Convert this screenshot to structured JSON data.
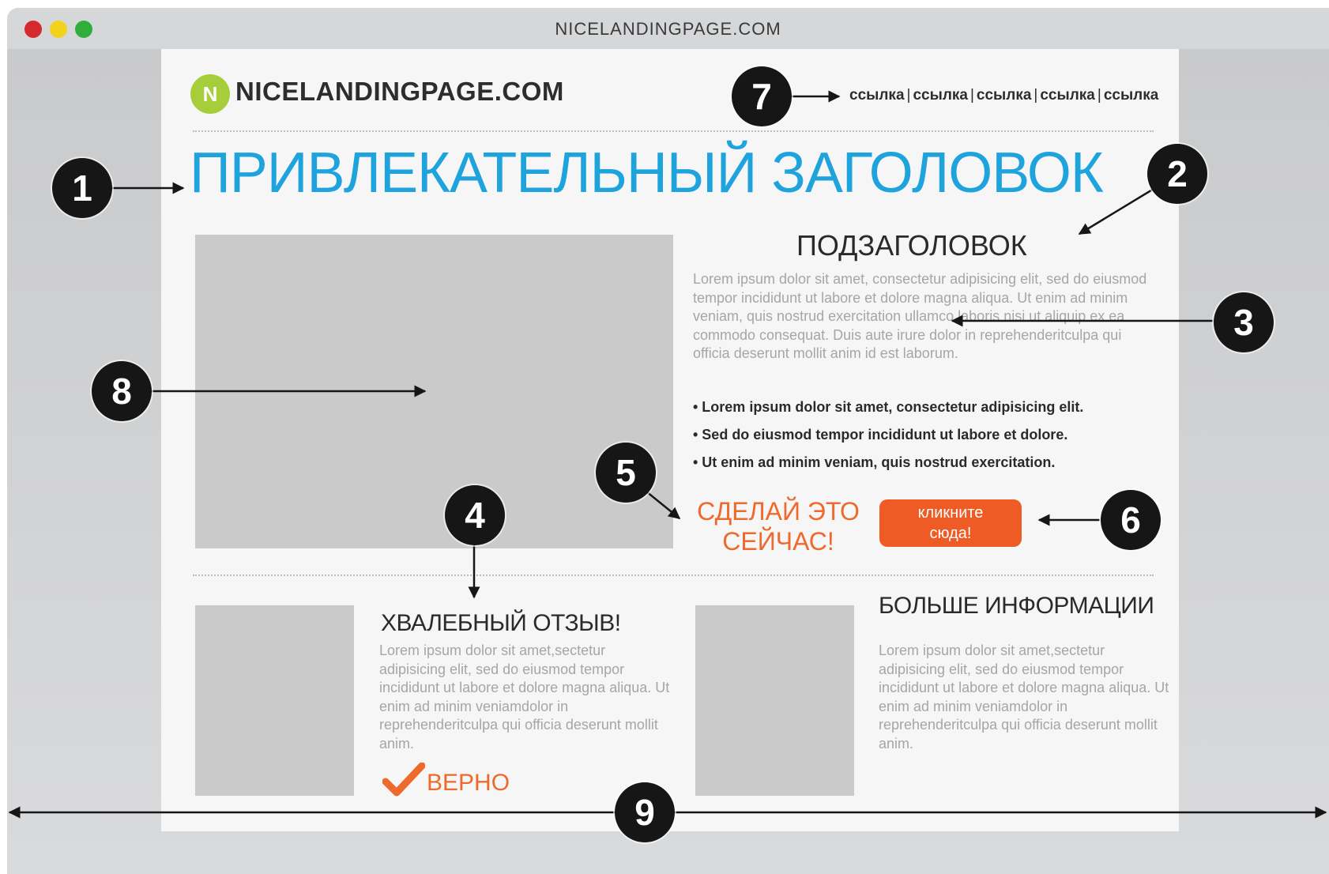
{
  "window": {
    "title": "NICELANDINGPAGE.COM",
    "colors": {
      "close": "#d42a2e",
      "minimize": "#f3d21d",
      "maximize": "#2fae3c"
    }
  },
  "header": {
    "logo_letter": "N",
    "logo_text": "NICELANDINGPAGE.COM",
    "nav_links": [
      "ссылка",
      "ссылка",
      "ссылка",
      "ссылка",
      "ссылка"
    ],
    "nav_separator": "|"
  },
  "main": {
    "headline": "ПРИВЛЕКАТЕЛЬНЫЙ ЗАГОЛОВОК",
    "subheadline": "ПОДЗАГОЛОВОК",
    "body": "Lorem ipsum dolor sit amet, consectetur adipisicing elit, sed do eiusmod tempor incididunt ut labore et dolore magna aliqua. Ut enim ad minim veniam, quis nostrud exercitation ullamco laboris nisi ut aliquip ex ea commodo consequat. Duis aute irure dolor in reprehenderitculpa qui officia deserunt mollit anim id est laborum.",
    "bullets": [
      "• Lorem ipsum dolor sit amet, consectetur adipisicing elit.",
      "• Sed do eiusmod tempor incididunt ut labore et dolore.",
      "• Ut enim ad minim veniam, quis nostrud exercitation."
    ],
    "cta_text_line1": "СДЕЛАЙ ЭТО",
    "cta_text_line2": "СЕЙЧАС!",
    "cta_button_line1": "кликните",
    "cta_button_line2": "сюда!"
  },
  "testimonial": {
    "title": "ХВАЛЕБНЫЙ ОТЗЫВ!",
    "text": "Lorem ipsum dolor sit amet,sectetur adipisicing elit, sed do eiusmod tempor incididunt ut labore et dolore magna aliqua. Ut enim ad minim veniamdolor in reprehenderitculpa qui officia deserunt mollit anim.",
    "verdict": "ВЕРНО",
    "check_icon": "checkmark-icon"
  },
  "more_info": {
    "title": "БОЛЬШЕ ИНФОРМАЦИИ",
    "text": "Lorem ipsum dolor sit amet,sectetur adipisicing elit, sed do eiusmod tempor incididunt ut labore et dolore magna aliqua. Ut enim ad minim veniamdolor in reprehenderitculpa qui officia deserunt mollit anim."
  },
  "markers": [
    "1",
    "2",
    "3",
    "4",
    "5",
    "6",
    "7",
    "8",
    "9"
  ],
  "colors": {
    "headline": "#1ea3dd",
    "accent": "#ee6a2c",
    "button": "#ef5b24",
    "logo": "#a6cd3a",
    "placeholder": "#cacacb",
    "marker": "#161616"
  }
}
